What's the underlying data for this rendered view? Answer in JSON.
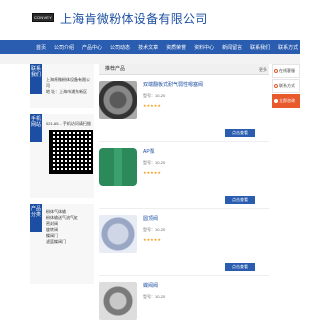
{
  "header": {
    "logo_text": "CONVEY",
    "company_name": "上海肯微粉体设备有限公司"
  },
  "nav": {
    "items": [
      "首页",
      "公司介绍",
      "产品中心",
      "公司动态",
      "技术文章",
      "资质荣誉",
      "资料中心",
      "新闻留言",
      "联系我们",
      "联系方式"
    ]
  },
  "sidebar": {
    "contact": {
      "tag": "联系我们",
      "company": "上海肯微粉体设备有限公司",
      "address": "地 址：上海市浦东新区"
    },
    "mobile": {
      "tag": "手机网站",
      "phone": "021-65... 手机访问请扫描"
    },
    "products": {
      "tag": "产品分类",
      "items": [
        "粉体气体输",
        "粉体输送气流气缸",
        "密封阀",
        "旋转阀",
        "蝶阀门",
        "滤篮蝶阀门"
      ]
    }
  },
  "main": {
    "title": "推荐产品",
    "more": "更多",
    "products": [
      {
        "name": "双端翻板式耐气弱性嗯塞阀",
        "spec": "型号：10-20",
        "stars": "★★★★★",
        "date": "",
        "views": "",
        "button": "点击查看"
      },
      {
        "name": "AP泵",
        "spec": "型号：10-20",
        "stars": "★★★★★",
        "date": "",
        "views": "",
        "button": "点击查看"
      },
      {
        "name": "圆顶阀",
        "spec": "型号：10-20",
        "stars": "★★★★★",
        "date": "",
        "views": "",
        "button": "点击查看"
      },
      {
        "name": "蝶阀阀",
        "spec": "型号：10-20",
        "stars": "",
        "date": "",
        "views": "",
        "button": ""
      }
    ]
  },
  "right_panel": {
    "items": [
      {
        "label": "在线客服"
      },
      {
        "label": "联系方式"
      },
      {
        "label": "立即咨询",
        "active": true
      }
    ]
  }
}
